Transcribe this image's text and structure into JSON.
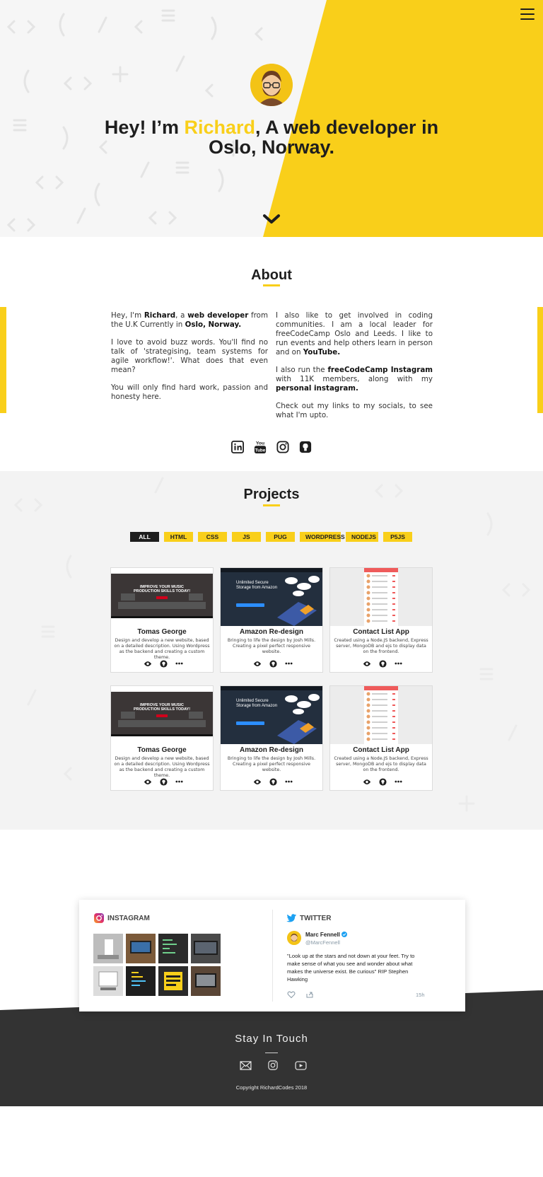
{
  "hero": {
    "title_part1": "Hey! I’m ",
    "title_name": "Richard",
    "title_part2": ", A web developer in Oslo, Norway."
  },
  "about": {
    "title": "About",
    "col1": {
      "p1_a": "Hey, I'm ",
      "p1_b": "Richard",
      "p1_c": ", a ",
      "p1_d": "web developer",
      "p1_e": " from the U.K Currently in ",
      "p1_f": "Oslo, Norway.",
      "p2": "I love to avoid buzz words. You'll find no talk of 'strategising, team systems for agile workflow!'. What does that even mean?",
      "p3": "You will only find hard work, passion and honesty here."
    },
    "col2": {
      "p1_a": "I also like to get involved in coding communities. I am a local leader for freeCodeCamp Oslo and Leeds. I like to run events and help others learn in person and on ",
      "p1_b": "YouTube.",
      "p2_a": "I also run the ",
      "p2_b": "freeCodeCamp Instagram",
      "p2_c": " with 11K members, along with my ",
      "p2_d": "personal instagram.",
      "p3": "Check out my links to my socials, to see what I'm upto."
    },
    "socials": [
      {
        "icon": "linkedin-icon"
      },
      {
        "icon": "youtube-icon"
      },
      {
        "icon": "instagram-icon"
      },
      {
        "icon": "github-icon"
      }
    ]
  },
  "projects": {
    "title": "Projects",
    "filters": [
      "ALL",
      "HTML",
      "CSS",
      "JS",
      "PUG",
      "WORDPRESS",
      "NODEJS",
      "P5JS"
    ],
    "active_filter": "ALL",
    "cards": [
      {
        "title": "Tomas George",
        "desc": "Design and develop a new website, based on a detailed description. Using Wordpress as the backend and creating a custom theme.",
        "thumb_text": "IMPROVE YOUR MUSIC PRODUCTION SKILLS TODAY!"
      },
      {
        "title": "Amazon Re-design",
        "desc": "Bringing to life the design by Josh Mills. Creating a pixel perfect responsive website.",
        "thumb_text": "Unlimited Secure Storage from Amazon"
      },
      {
        "title": "Contact List App",
        "desc": "Created using a Node.JS backend, Express server, MongoDB and ejs to display data on the frontend.",
        "thumb_text": ""
      },
      {
        "title": "Tomas George",
        "desc": "Design and develop a new website, based on a detailed description. Using Wordpress as the backend and creating a custom theme.",
        "thumb_text": "IMPROVE YOUR MUSIC PRODUCTION SKILLS TODAY!"
      },
      {
        "title": "Amazon Re-design",
        "desc": "Bringing to life the design by Josh Mills. Creating a pixel perfect responsive website.",
        "thumb_text": "Unlimited Secure Storage from Amazon"
      },
      {
        "title": "Contact List App",
        "desc": "Created using a Node.JS backend, Express server, MongoDB and ejs to display data on the frontend.",
        "thumb_text": ""
      }
    ]
  },
  "feeds": {
    "instagram_label": "INSTAGRAM",
    "twitter_label": "TWITTER",
    "tweet": {
      "name": "Marc Fennell",
      "handle": "@MarcFennell",
      "text": "\"Look up at the stars and not down at your feet. Try to make sense of what you see and wonder about what makes the universe exist. Be curious\" RIP Stephen Hawking",
      "time": "15h"
    }
  },
  "footer": {
    "title": "Stay In Touch",
    "icons": [
      "mail-icon",
      "instagram-icon",
      "youtube-icon"
    ],
    "copyright": "Copyright RichardCodes 2018"
  },
  "colors": {
    "accent": "#f9cf1a",
    "dark": "#333333",
    "text": "#1e1e1e"
  }
}
